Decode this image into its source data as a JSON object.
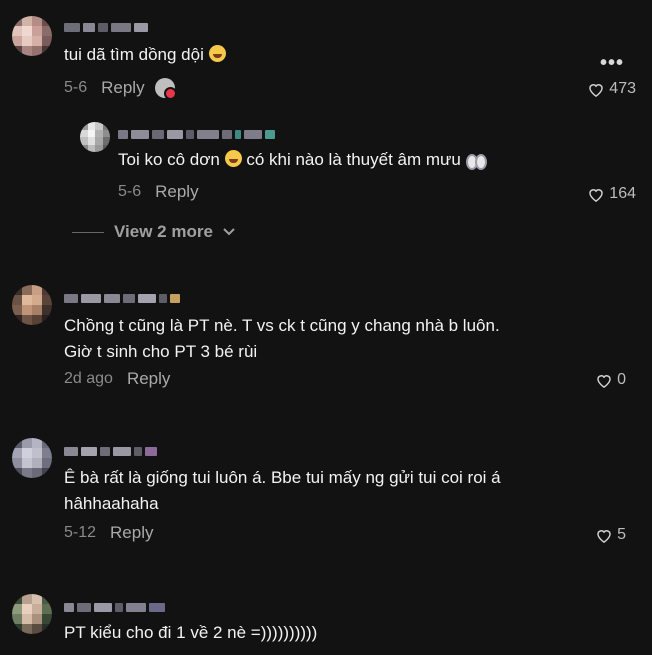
{
  "menu": {
    "dots": "•••"
  },
  "comments": [
    {
      "text": "tui dã tìm dồng dội",
      "date": "5-6",
      "reply": "Reply",
      "likes": "473"
    },
    {
      "text": "Toi ko cô dơn",
      "text_after": " có khi nào là thuyết âm mưu",
      "date": "5-6",
      "reply": "Reply",
      "likes": "164"
    },
    {
      "line1": "Chồng t cũng là PT nè. T vs ck t cũng y chang nhà b luôn.",
      "line2": "Giờ t sinh cho PT 3 bé rùi",
      "date": "2d ago",
      "reply": "Reply",
      "likes": "0"
    },
    {
      "line1": "Ê bà rất là giống tui luôn á. Bbe tui mấy ng gửi tui coi roi á",
      "line2": "hâhhaahaha",
      "date": "5-12",
      "reply": "Reply",
      "likes": "5"
    },
    {
      "text": "PT kiểu cho đi 1 về 2 nè =))))))))))"
    }
  ],
  "view_more": {
    "label": "View 2 more"
  },
  "icons": [
    "more-icon",
    "heart-icon",
    "chevron-down-icon",
    "grin-emoji-icon",
    "eyes-emoji-icon"
  ]
}
